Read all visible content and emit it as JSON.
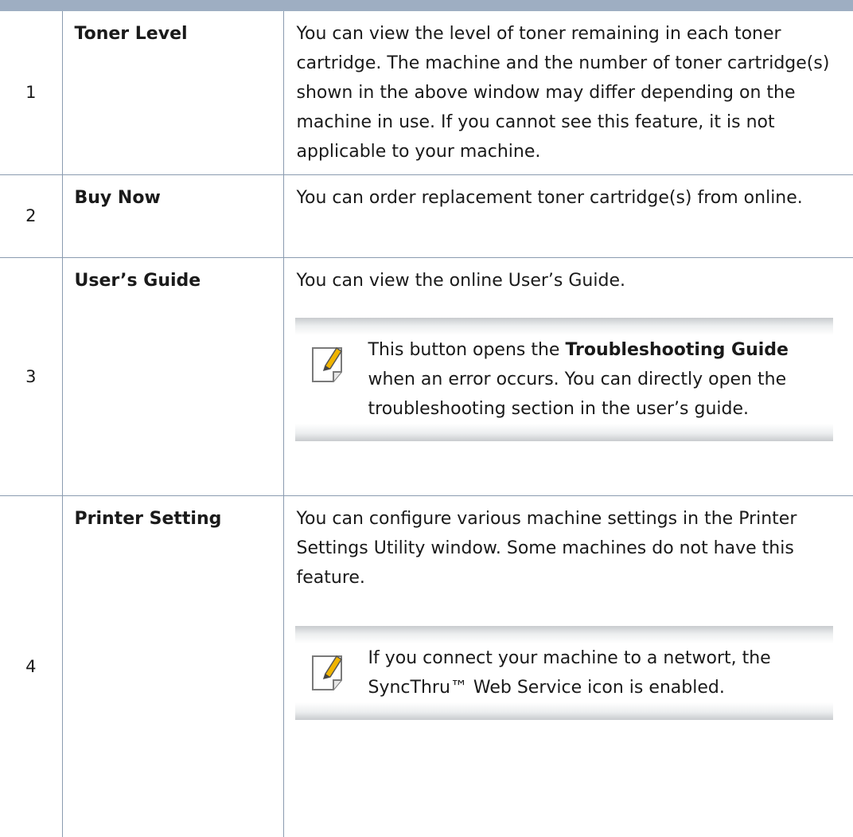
{
  "rows": [
    {
      "number": "1",
      "name": "Toner Level",
      "description": "You can view the level of toner remaining in each toner cartridge. The machine and the number of toner cartridge(s) shown in the above window may differ depending on the machine in use. If you cannot see this feature, it is not applicable to your machine."
    },
    {
      "number": "2",
      "name": "Buy Now",
      "description": "You can order replacement toner cartridge(s) from online."
    },
    {
      "number": "3",
      "name": "User’s Guide",
      "description": "You can view the online User’s Guide.",
      "note": {
        "icon": "note-pencil-icon",
        "text_before": "This button opens the ",
        "bold": "Troubleshooting Guide",
        "text_after": " when an error occurs. You can directly open the troubleshooting section in the user’s guide."
      }
    },
    {
      "number": "4",
      "name": "Printer Setting",
      "description": "You can configure various machine settings in the Printer Settings Utility window. Some machines do not have this feature.",
      "note": {
        "icon": "note-pencil-icon",
        "text": "If you connect your machine to a networt, the SyncThru™ Web Service icon is enabled."
      }
    }
  ],
  "colors": {
    "header_bar": "#9eaec2",
    "border": "#8a9bb0",
    "note_shade": "#c8cbce",
    "pencil": "#f0b400"
  }
}
